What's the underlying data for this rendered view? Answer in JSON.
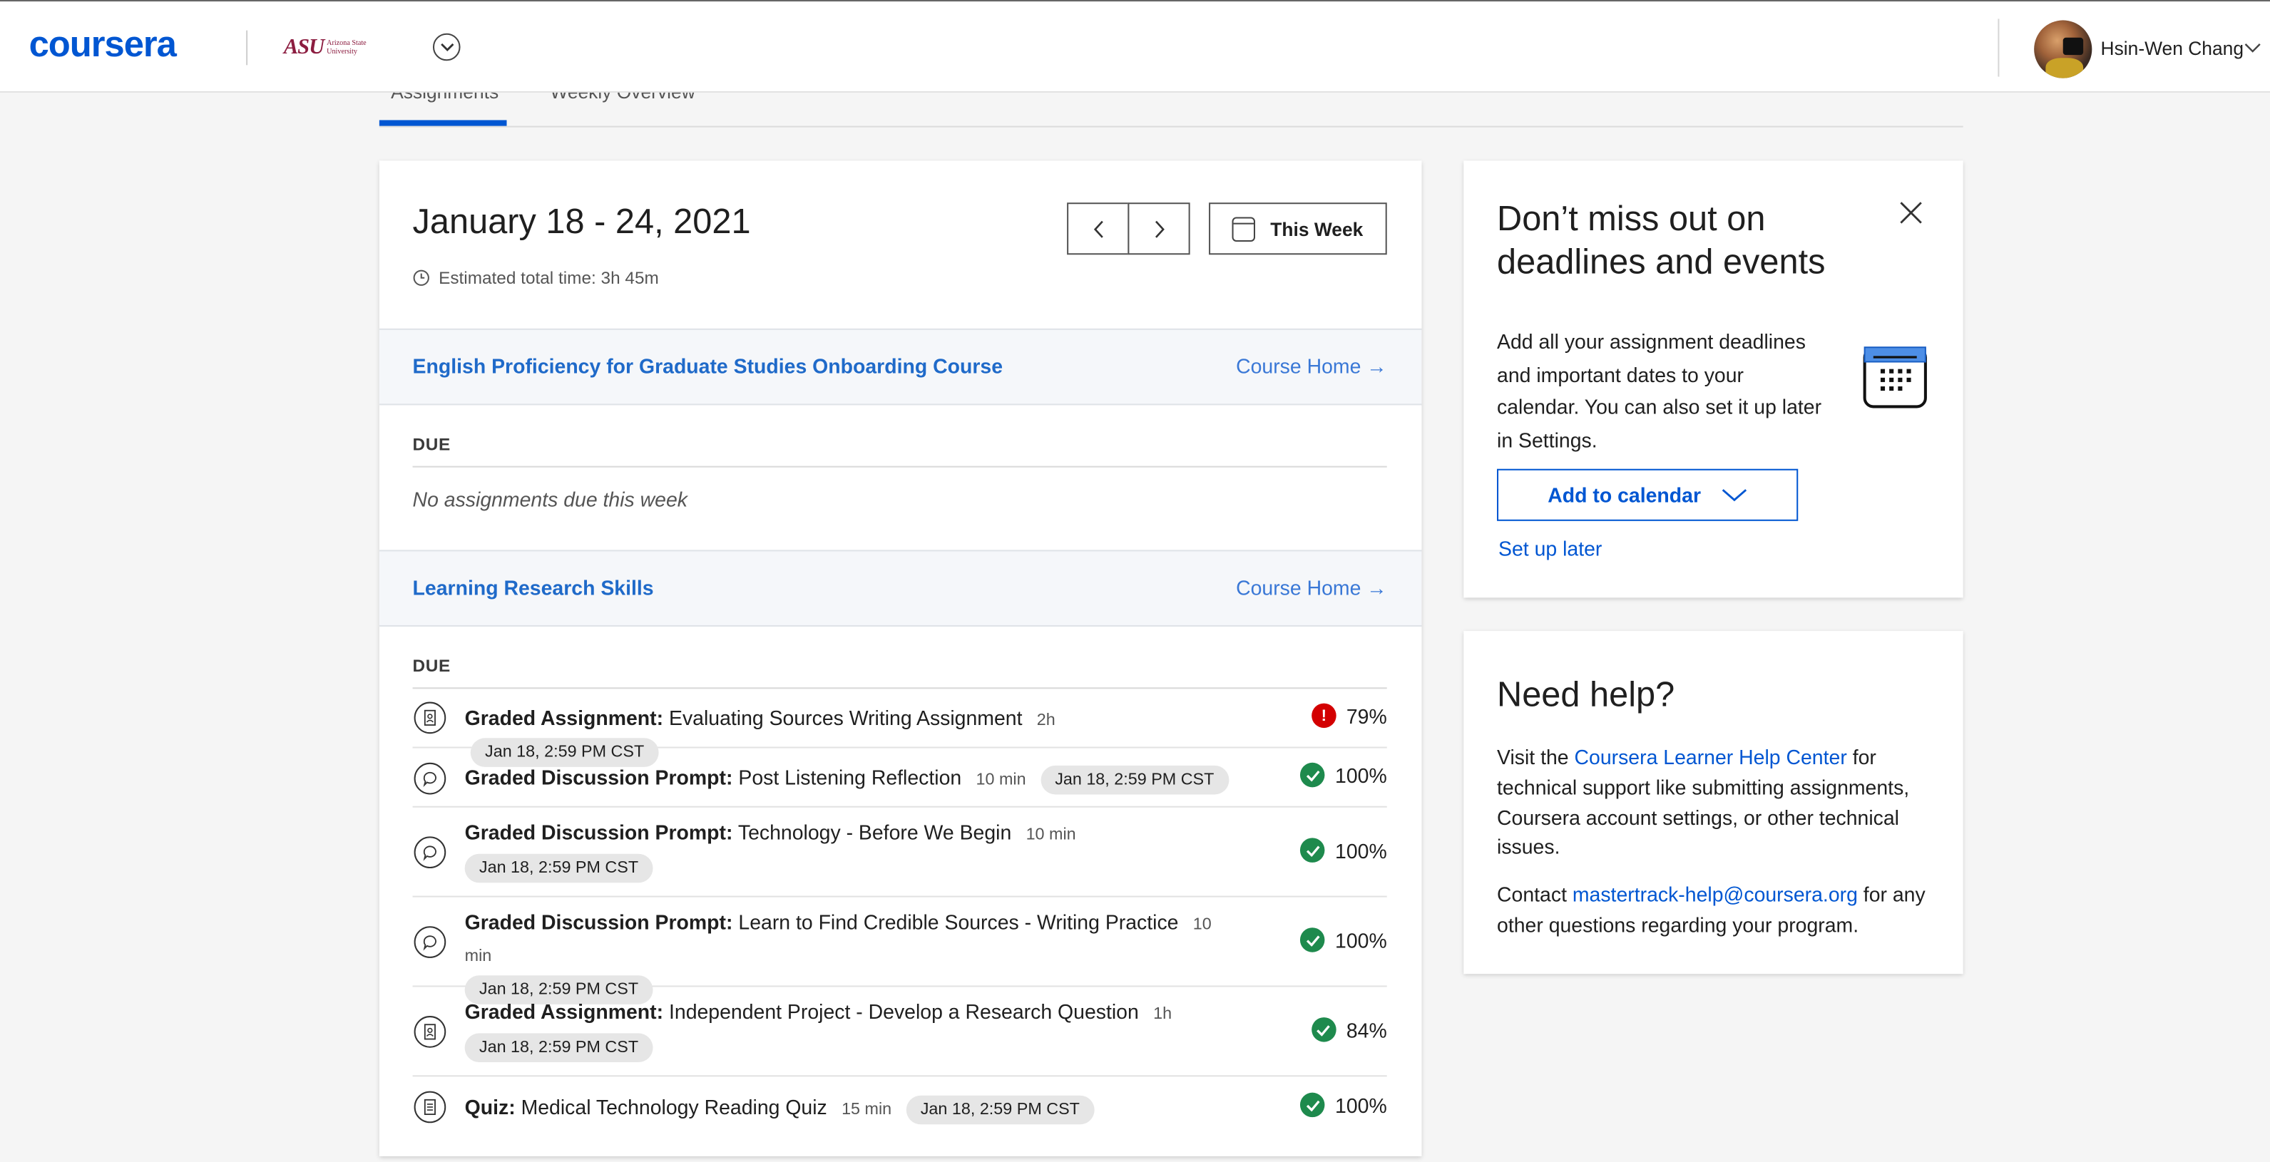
{
  "header": {
    "logo": "coursera",
    "partner_mark": "ASU",
    "partner_text": "Arizona State University",
    "username": "Hsin-Wen Chang"
  },
  "tabs": [
    "Assignments",
    "Weekly Overview"
  ],
  "week": {
    "title": "January 18 - 24, 2021",
    "estimated": "Estimated total time: 3h 45m",
    "this_week_label": "This Week"
  },
  "courses": [
    {
      "name": "English Proficiency for Graduate Studies Onboarding Course",
      "home_label": "Course Home →",
      "due_label": "DUE",
      "empty_message": "No assignments due this week"
    },
    {
      "name": "Learning Research Skills",
      "home_label": "Course Home →",
      "due_label": "DUE",
      "assignments": [
        {
          "icon": "graded-assignment-icon",
          "type": "Graded Assignment:",
          "title": "Evaluating Sources Writing Assignment",
          "duration": "2h",
          "due": "Jan 18, 2:59 PM CST",
          "grade": "79%",
          "status": "warning"
        },
        {
          "icon": "discussion-icon",
          "type": "Graded Discussion Prompt:",
          "title": "Post Listening Reflection",
          "duration": "10 min",
          "due": "Jan 18, 2:59 PM CST",
          "grade": "100%",
          "status": "passed"
        },
        {
          "icon": "discussion-icon",
          "type": "Graded Discussion Prompt:",
          "title": "Technology - Before We Begin",
          "duration": "10 min",
          "due": "Jan 18, 2:59 PM CST",
          "grade": "100%",
          "status": "passed"
        },
        {
          "icon": "discussion-icon",
          "type": "Graded Discussion Prompt:",
          "title": "Learn to Find Credible Sources - Writing Practice",
          "duration": "10 min",
          "due": "Jan 18, 2:59 PM CST",
          "grade": "100%",
          "status": "passed"
        },
        {
          "icon": "graded-assignment-icon",
          "type": "Graded Assignment:",
          "title": "Independent Project - Develop a Research Question",
          "duration": "1h",
          "due": "Jan 18, 2:59 PM CST",
          "grade": "84%",
          "status": "passed"
        },
        {
          "icon": "quiz-icon",
          "type": "Quiz:",
          "title": "Medical Technology Reading Quiz",
          "duration": "15 min",
          "due": "Jan 18, 2:59 PM CST",
          "grade": "100%",
          "status": "passed"
        }
      ]
    }
  ],
  "calendar_card": {
    "title": "Don’t miss out on deadlines and events",
    "description": "Add all your assignment deadlines and important dates to your calendar. You can also set it up later in Settings.",
    "add_label": "Add to calendar",
    "later_label": "Set up later"
  },
  "help_card": {
    "title": "Need help?",
    "p1_before": "Visit the ",
    "p1_link": "Coursera Learner Help Center",
    "p1_after": " for technical support like submitting assignments, Coursera account settings, or other technical issues.",
    "p2_before": "Contact ",
    "p2_link": "mastertrack-help@coursera.org",
    "p2_after": " for any other questions regarding your program."
  },
  "colors": {
    "brand": "#0056d2",
    "course_link": "#1f6ac9",
    "passed": "#1e8a4d",
    "warning": "#d30001",
    "asu": "#8c1d40"
  }
}
